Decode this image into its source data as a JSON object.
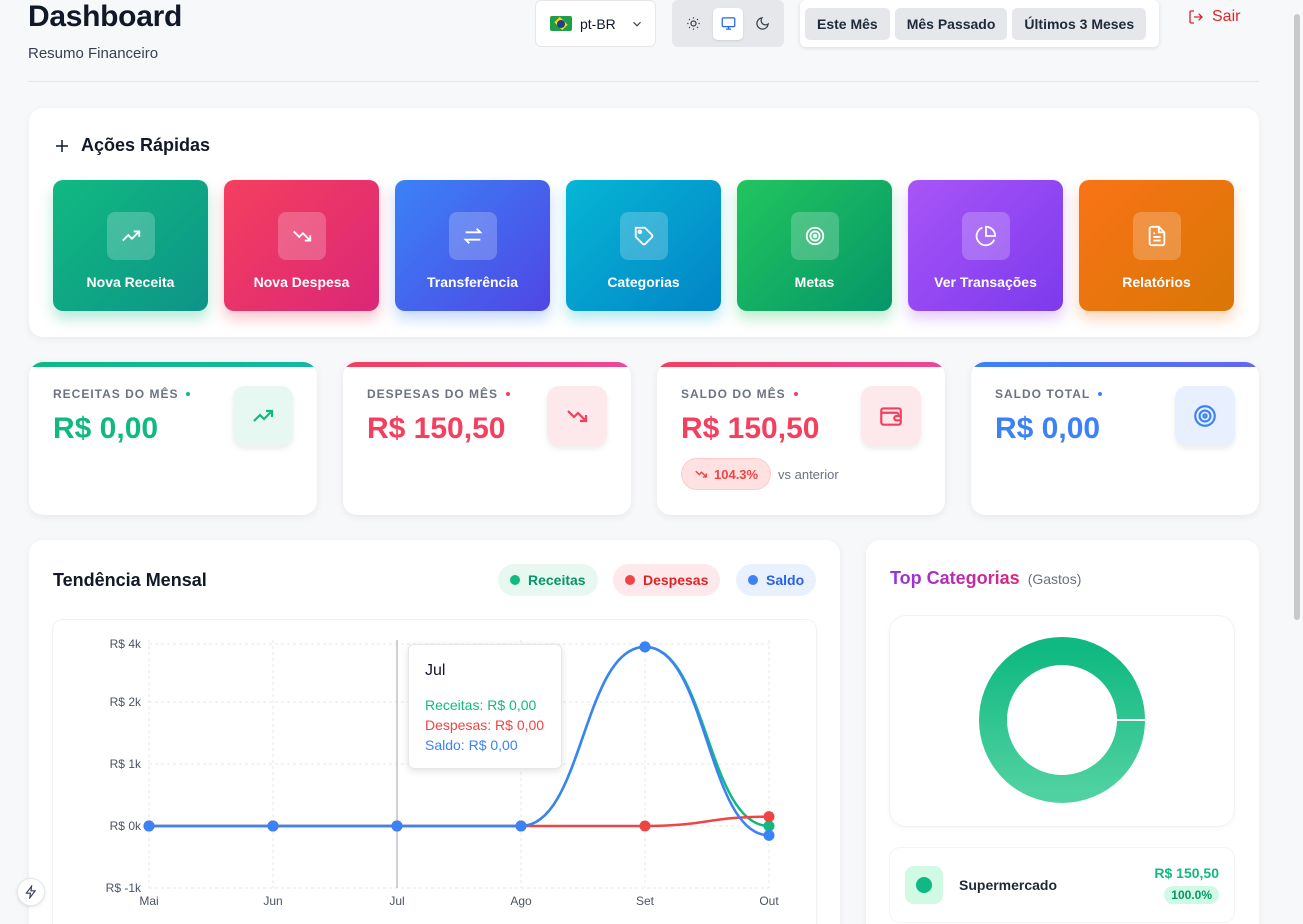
{
  "header": {
    "title": "Dashboard",
    "subtitle": "Resumo Financeiro",
    "language": "pt-BR",
    "periods": [
      "Este Mês",
      "Mês Passado",
      "Últimos 3 Meses"
    ],
    "logout_label": "Sair",
    "theme_options": [
      "sun-icon",
      "monitor-icon",
      "moon-icon"
    ],
    "theme_active": "monitor-icon"
  },
  "quick_actions": {
    "title": "Ações Rápidas",
    "items": [
      {
        "label": "Nova Receita",
        "icon": "trending-up-icon",
        "color": "#10b981"
      },
      {
        "label": "Nova Despesa",
        "icon": "trending-down-icon",
        "color": "#f43f5e"
      },
      {
        "label": "Transferência",
        "icon": "arrows-exchange-icon",
        "color": "#3b82f6"
      },
      {
        "label": "Categorias",
        "icon": "tag-icon",
        "color": "#06b6d4"
      },
      {
        "label": "Metas",
        "icon": "target-icon",
        "color": "#22c55e"
      },
      {
        "label": "Ver Transações",
        "icon": "pie-chart-icon",
        "color": "#a855f7"
      },
      {
        "label": "Relatórios",
        "icon": "file-text-icon",
        "color": "#f97316"
      }
    ]
  },
  "stats": [
    {
      "label": "RECEITAS DO MÊS",
      "value": "R$ 0,00",
      "color": "#10b981",
      "icon": "trending-up-icon"
    },
    {
      "label": "DESPESAS DO MÊS",
      "value": "R$ 150,50",
      "color": "#f43f5e",
      "icon": "trending-down-icon"
    },
    {
      "label": "SALDO DO MÊS",
      "value": "R$ 150,50",
      "color": "#f43f5e",
      "icon": "wallet-icon",
      "trend": "104.3%",
      "trend_caption": "vs anterior"
    },
    {
      "label": "SALDO TOTAL",
      "value": "R$ 0,00",
      "color": "#3b82f6",
      "icon": "target-icon"
    }
  ],
  "trend": {
    "title": "Tendência Mensal",
    "legend": [
      "Receitas",
      "Despesas",
      "Saldo"
    ],
    "tooltip": {
      "title": "Jul",
      "rows": [
        "Receitas: R$ 0,00",
        "Despesas: R$ 0,00",
        "Saldo: R$ 0,00"
      ]
    }
  },
  "chart_data": {
    "type": "line",
    "x": [
      "Mai",
      "Jun",
      "Jul",
      "Ago",
      "Set",
      "Out"
    ],
    "y_ticks": [
      "R$ 4k",
      "R$ 2k",
      "R$ 1k",
      "R$ 0k",
      "R$ -1k"
    ],
    "ylim": [
      -1000,
      4000
    ],
    "grid": true,
    "legend_placement": "top-right",
    "series": [
      {
        "name": "Receitas",
        "color": "#10b981",
        "values": [
          0,
          0,
          0,
          0,
          3900,
          0
        ]
      },
      {
        "name": "Despesas",
        "color": "#ef4444",
        "values": [
          0,
          0,
          0,
          0,
          0,
          150.5
        ]
      },
      {
        "name": "Saldo",
        "color": "#3b82f6",
        "values": [
          0,
          0,
          0,
          0,
          3900,
          -150.5
        ]
      }
    ],
    "highlight": "Jul"
  },
  "categories": {
    "title": "Top Categorias",
    "subtitle": "(Gastos)",
    "items": [
      {
        "name": "Supermercado",
        "amount": "R$ 150,50",
        "percent": "100.0%",
        "share": 1.0,
        "color": "#10b981"
      }
    ]
  }
}
